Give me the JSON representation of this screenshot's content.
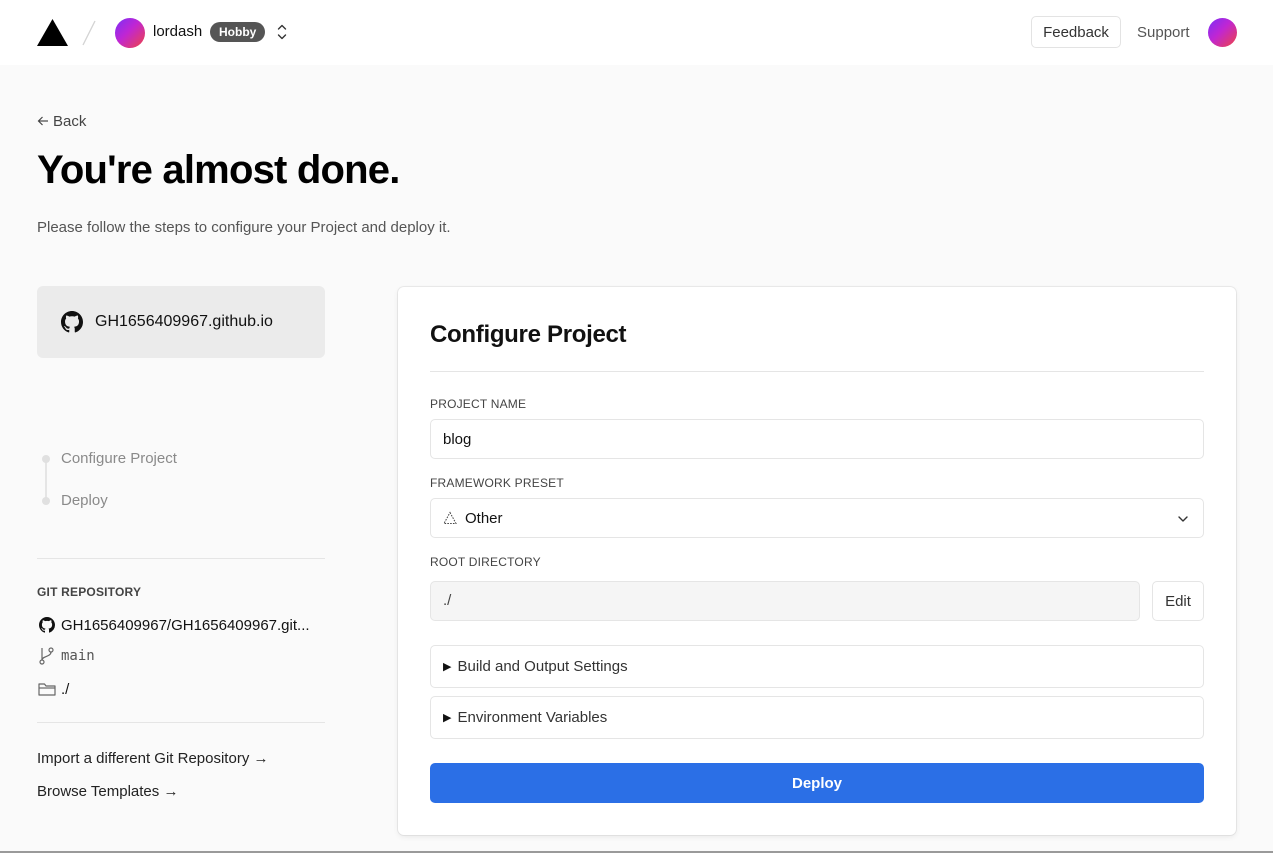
{
  "header": {
    "team_name": "lordash",
    "plan_badge": "Hobby",
    "feedback_label": "Feedback",
    "support_label": "Support"
  },
  "page": {
    "back_label": "Back",
    "title": "You're almost done.",
    "subtitle": "Please follow the steps to configure your Project and deploy it."
  },
  "repo_card": {
    "name": "GH1656409967.github.io",
    "icon": "github-icon"
  },
  "steps": [
    {
      "label": "Configure Project"
    },
    {
      "label": "Deploy"
    }
  ],
  "git": {
    "heading": "GIT REPOSITORY",
    "repository": "GH1656409967/GH1656409967.git...",
    "branch": "main",
    "directory": "./"
  },
  "links": {
    "import_repo": "Import a different Git Repository →",
    "browse_templates": "Browse Templates →"
  },
  "configure": {
    "title": "Configure Project",
    "project_name_label": "PROJECT NAME",
    "project_name_value": "blog",
    "framework_label": "FRAMEWORK PRESET",
    "framework_value": "Other",
    "root_label": "ROOT DIRECTORY",
    "root_value": "./",
    "edit_label": "Edit",
    "build_settings_label": "Build and Output Settings",
    "env_vars_label": "Environment Variables",
    "deploy_label": "Deploy"
  },
  "colors": {
    "deploy_button": "#2b6fe6",
    "page_background": "#fafafa",
    "plan_badge": "#555555"
  }
}
